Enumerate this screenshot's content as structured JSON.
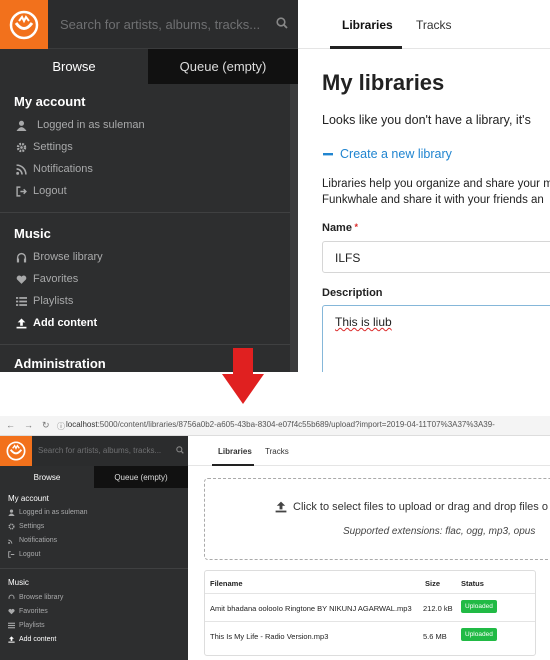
{
  "top": {
    "search": {
      "placeholder": "Search for artists, albums, tracks..."
    },
    "sidebar_tabs": {
      "browse": "Browse",
      "queue": "Queue (empty)"
    },
    "my_account": {
      "title": "My account",
      "items": [
        {
          "label": "Logged in as suleman",
          "icon": "user-icon"
        },
        {
          "label": "Settings",
          "icon": "gear-icon"
        },
        {
          "label": "Notifications",
          "icon": "rss-icon"
        },
        {
          "label": "Logout",
          "icon": "logout-icon"
        }
      ]
    },
    "music": {
      "title": "Music",
      "items": [
        {
          "label": "Browse library",
          "icon": "headphones-icon"
        },
        {
          "label": "Favorites",
          "icon": "heart-icon"
        },
        {
          "label": "Playlists",
          "icon": "list-icon"
        },
        {
          "label": "Add content",
          "icon": "upload-icon"
        }
      ]
    },
    "administration": {
      "title": "Administration"
    },
    "main_tabs": {
      "libraries": "Libraries",
      "tracks": "Tracks"
    },
    "heading": "My libraries",
    "intro": "Looks like you don't have a library, it's",
    "create_link": "Create a new library",
    "help_line1": "Libraries help you organize and share your m",
    "help_line2": "Funkwhale and share it with your friends an",
    "name_label": "Name",
    "name_value": "ILFS",
    "description_label": "Description",
    "description_value": "This is liub"
  },
  "bottom": {
    "url": {
      "host": "localhost",
      "rest": ":5000/content/libraries/8756a0b2-a605-43ba-8304-e07f4c55b689/upload?import=2019-04-11T07%3A37%3A39-"
    },
    "search": {
      "placeholder": "Search for artists, albums, tracks..."
    },
    "sidebar_tabs": {
      "browse": "Browse",
      "queue": "Queue (empty)"
    },
    "my_account": {
      "title": "My account",
      "items": [
        "Logged in as suleman",
        "Settings",
        "Notifications",
        "Logout"
      ]
    },
    "music": {
      "title": "Music",
      "items": [
        "Browse library",
        "Favorites",
        "Playlists",
        "Add content"
      ]
    },
    "main_tabs": {
      "libraries": "Libraries",
      "tracks": "Tracks"
    },
    "dropzone": {
      "main": "Click to select files to upload or drag and drop files o",
      "sub": "Supported extensions: flac, ogg, mp3, opus"
    },
    "table": {
      "headers": {
        "filename": "Filename",
        "size": "Size",
        "status": "Status"
      },
      "rows": [
        {
          "filename": "Amit bhadana oolooIo Ringtone BY NIKUNJ AGARWAL.mp3",
          "size": "212.0 kB",
          "status": "Uploaded"
        },
        {
          "filename": "This Is My Life - Radio Version.mp3",
          "size": "5.6 MB",
          "status": "Uploaded"
        }
      ]
    }
  },
  "colors": {
    "brand": "#f2711c",
    "link": "#2185d0",
    "success": "#21ba45",
    "arrow": "#e02020",
    "sidebar": "#2d2e2f"
  }
}
